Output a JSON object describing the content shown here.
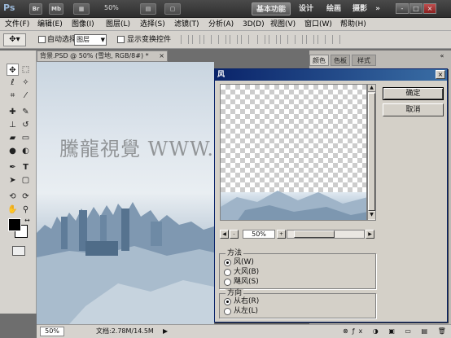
{
  "app": {
    "logo": "Ps",
    "buttons": [
      "Br",
      "Mb"
    ],
    "zoom": "50%",
    "workspaces": [
      "基本功能",
      "设计",
      "绘画",
      "摄影"
    ],
    "window_controls": [
      "-",
      "□",
      "×"
    ]
  },
  "menu": [
    "文件(F)",
    "编辑(E)",
    "图像(I)",
    "图层(L)",
    "选择(S)",
    "滤镜(T)",
    "分析(A)",
    "3D(D)",
    "视图(V)",
    "窗口(W)",
    "帮助(H)"
  ],
  "options": {
    "auto_select_label": "自动选择:",
    "auto_select_value": "图层",
    "show_transform_label": "显示变换控件"
  },
  "document": {
    "tab_title": "背景.PSD @ 50% (雪地, RGB/8#) *",
    "tab_close": "×",
    "watermark": "騰龍視覺 WWW.TLVI.NET",
    "status_zoom": "50%",
    "status_info": "文档:2.78M/14.5M"
  },
  "panels": {
    "tabs": [
      "颜色",
      "色板",
      "样式"
    ]
  },
  "dialog": {
    "title": "风",
    "ok": "确定",
    "cancel": "取消",
    "zoom": "50%",
    "zoom_minus": "-",
    "zoom_plus": "+",
    "method_label": "方法",
    "methods": [
      "风(W)",
      "大风(B)",
      "飓风(S)"
    ],
    "method_selected": 0,
    "direction_label": "方向",
    "directions": [
      "从右(R)",
      "从左(L)"
    ],
    "direction_selected": 0
  },
  "colors": {
    "title_bar": "#3a3a3a",
    "dialog_title": "#0a246a",
    "ui_gray": "#d6d3ce"
  }
}
